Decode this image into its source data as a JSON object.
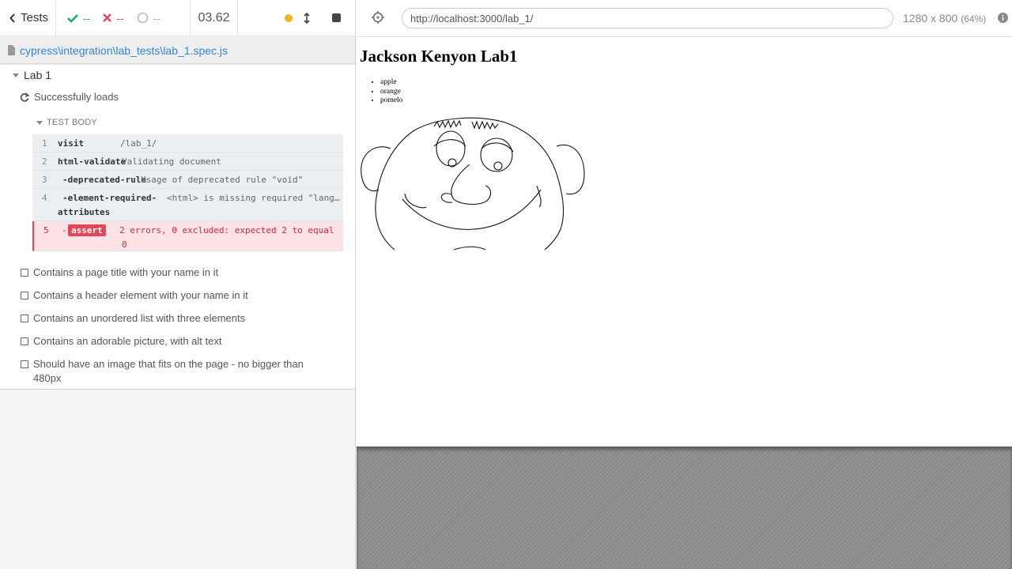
{
  "reporter": {
    "back_label": "Tests",
    "passed": "--",
    "failed": "--",
    "pending": "--",
    "duration": "03.62",
    "spec_path": "cypress\\integration\\lab_tests\\lab_1.spec.js",
    "colors": {
      "passed": "#1fa971",
      "failed": "#e0475a",
      "running": "#f6b026",
      "link": "#3386d4"
    }
  },
  "suite": {
    "title": "Lab 1",
    "running_test": "Successfully loads",
    "test_body_label": "TEST BODY",
    "commands": [
      {
        "num": "1",
        "name": "visit",
        "message": "/lab_1/"
      },
      {
        "num": "2",
        "name": "html-validate",
        "message": "Validating document"
      },
      {
        "num": "3",
        "name": "-deprecated-rule",
        "message": "Usage of deprecated rule \"void\""
      },
      {
        "num": "4",
        "name": "-element-required-",
        "name2": "attributes",
        "message": "<html> is missing required \"lang…"
      },
      {
        "num": "5",
        "name": "-",
        "badge": "assert",
        "message": "2 errors, 0 excluded: expected 2 to equal",
        "message2": "0"
      }
    ],
    "pending_tests": [
      "Contains a page title with your name in it",
      "Contains a header element with your name in it",
      "Contains an unordered list with three elements",
      "Contains an adorable picture, with alt text",
      "Should have an image that fits on the page - no bigger than 480px"
    ]
  },
  "runner": {
    "url": "http://localhost:3000/lab_1/",
    "viewport": "1280 x 800",
    "scale": "(64%)"
  },
  "aut": {
    "heading": "Jackson Kenyon Lab1",
    "list": [
      "apple",
      "orange",
      "pomelo"
    ]
  },
  "icons": [
    "chevron-left-icon",
    "check-icon",
    "x-icon",
    "spinner-icon",
    "resize-icon",
    "stop-icon",
    "file-icon",
    "refresh-icon",
    "caret-down-icon",
    "crosshair-icon",
    "info-icon"
  ]
}
